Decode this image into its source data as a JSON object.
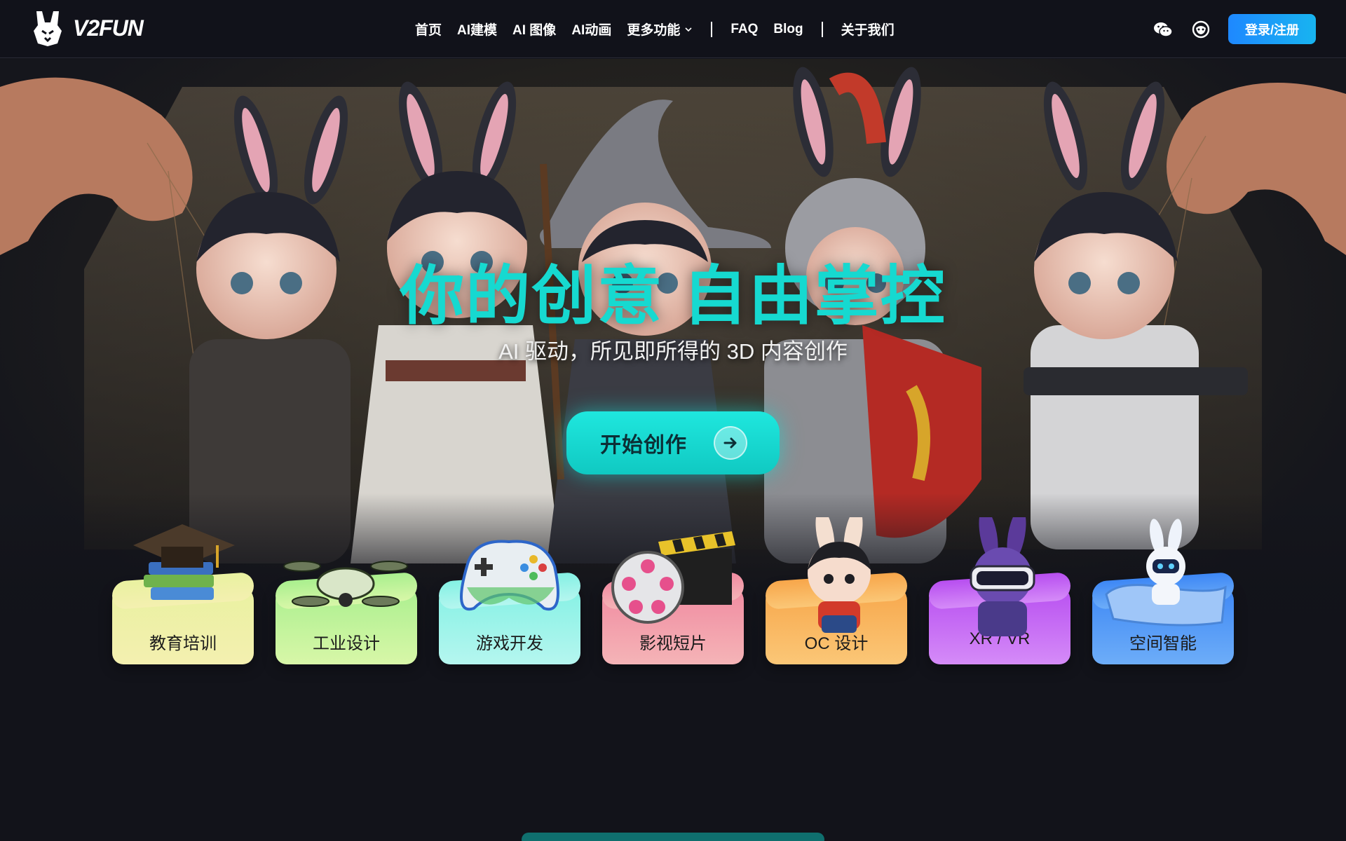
{
  "nav": {
    "brand": "V2FUN",
    "items": [
      {
        "label": "首页"
      },
      {
        "label": "AI建模"
      },
      {
        "label": "AI 图像"
      },
      {
        "label": "AI动画"
      },
      {
        "label": "更多功能"
      },
      {
        "label": "FAQ"
      },
      {
        "label": "Blog"
      },
      {
        "label": "关于我们"
      }
    ],
    "icons": [
      "wechat-icon",
      "discord-icon"
    ],
    "login_label": "登录/注册"
  },
  "hero": {
    "headline": "你的创意 自由掌控",
    "subline": "AI 驱动，所见即所得的 3D 内容创作",
    "cta_label": "开始创作"
  },
  "categories": [
    {
      "label": "教育培训",
      "gradient": [
        "#e9f1a0",
        "#f4f0b0"
      ]
    },
    {
      "label": "工业设计",
      "gradient": [
        "#a9ef8e",
        "#d8f7a8"
      ]
    },
    {
      "label": "游戏开发",
      "gradient": [
        "#84f1e4",
        "#b5f6ef"
      ]
    },
    {
      "label": "影视短片",
      "gradient": [
        "#f08aa0",
        "#f5b4b7"
      ]
    },
    {
      "label": "OC 设计",
      "gradient": [
        "#f7a64a",
        "#fbc777"
      ]
    },
    {
      "label": "XR / VR",
      "gradient": [
        "#b74ef0",
        "#d58bf8"
      ]
    },
    {
      "label": "空间智能",
      "gradient": [
        "#3d87f5",
        "#6dadf8"
      ]
    }
  ],
  "colors": {
    "accent": "#16d9d0",
    "nav_bg": "#11121a",
    "login_btn": "#1e88ff"
  }
}
